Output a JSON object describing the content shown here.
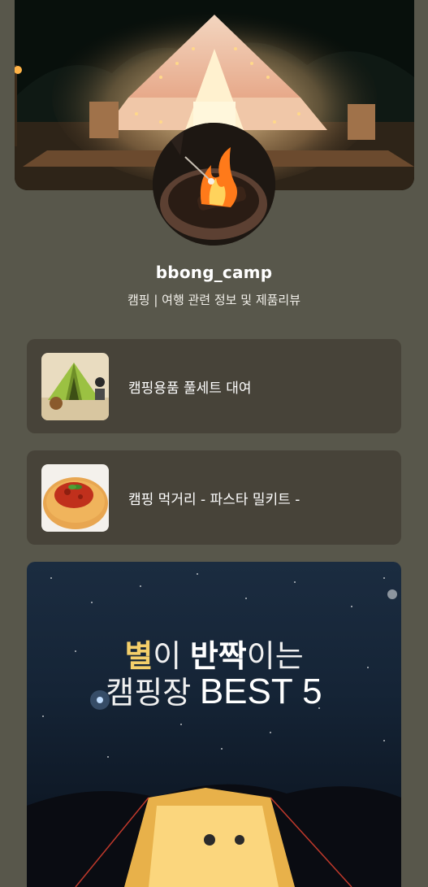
{
  "profile": {
    "username": "bbong_camp",
    "bio": "캠핑 | 여행 관련 정보 및 제품리뷰"
  },
  "links": [
    {
      "label": "캠핑용품 풀세트 대여",
      "icon": "tent-thumbnail"
    },
    {
      "label": "캠핑 먹거리 - 파스타 밀키트 -",
      "icon": "pasta-thumbnail"
    }
  ],
  "banner": {
    "w1a": "별",
    "w1b": "이 ",
    "w1c": "반짝",
    "w1d": "이는",
    "w2a": "캠핑장 ",
    "w2b": "BEST 5"
  },
  "colors": {
    "background": "#58574b",
    "card": "#474339",
    "accent_yellow": "#f4cf6a"
  }
}
